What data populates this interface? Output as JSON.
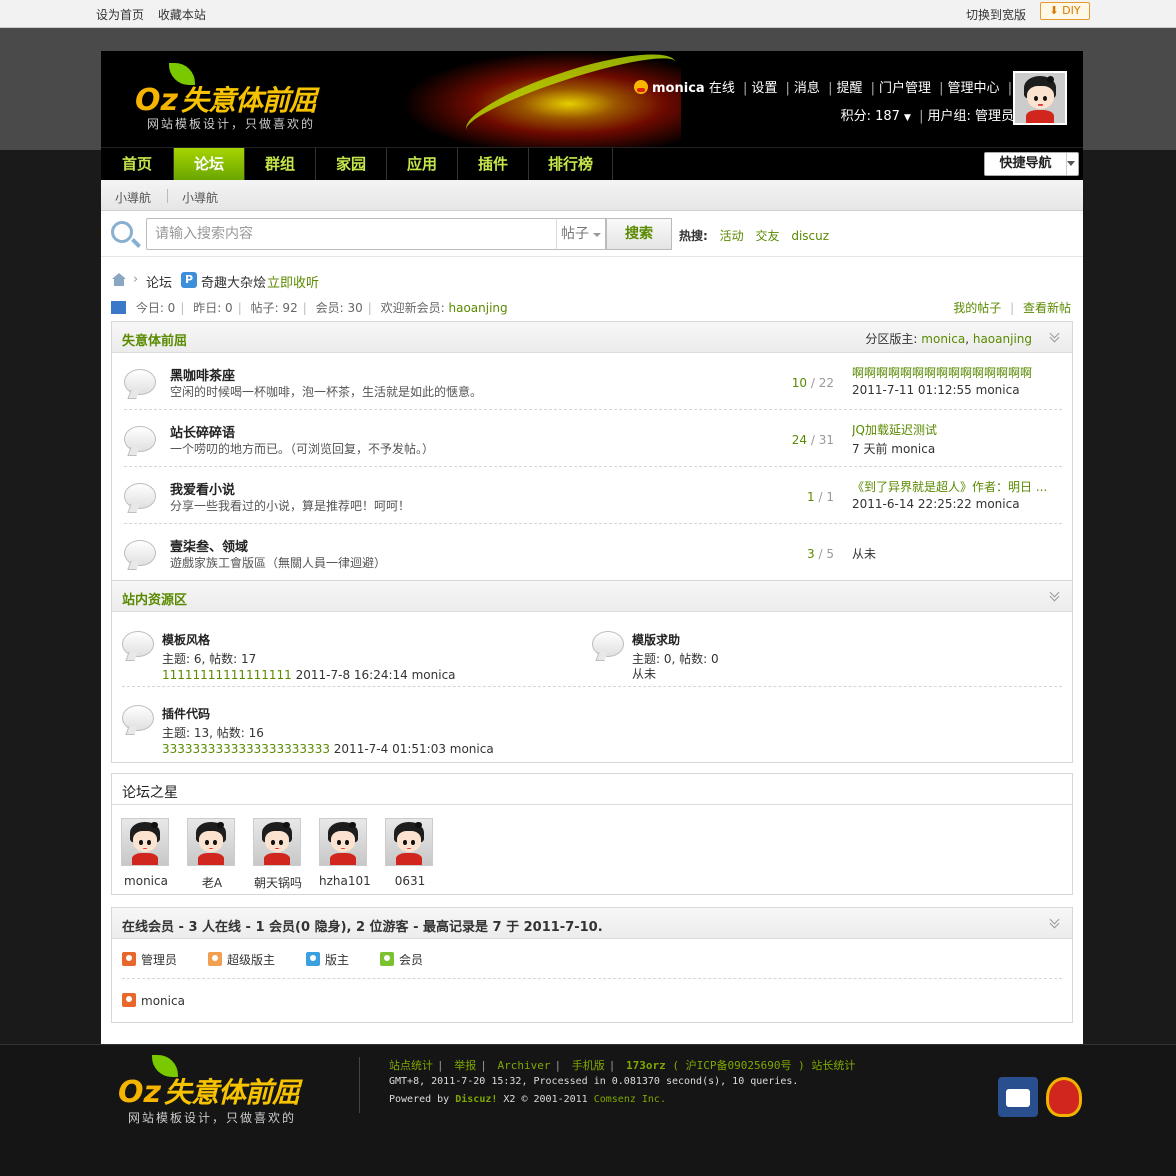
{
  "topbar": {
    "set_home": "设为首页",
    "bookmark": "收藏本站",
    "wide_switch": "切换到宽版",
    "diy": "DIY"
  },
  "logo": {
    "oz": "Oz",
    "name": "失意体前屈",
    "slogan": "网站模板设计，只做喜欢的"
  },
  "user": {
    "name": "monica",
    "status": "在线",
    "links": [
      "设置",
      "消息",
      "提醒",
      "门户管理",
      "管理中心",
      "退出"
    ],
    "points_label": "积分: 187",
    "group_label": "用户组: 管理员"
  },
  "nav": {
    "items": [
      "首页",
      "论坛",
      "群组",
      "家园",
      "应用",
      "插件",
      "排行榜"
    ],
    "quick": "快捷导航"
  },
  "subnav": [
    "小導航",
    "小導航"
  ],
  "search": {
    "placeholder": "请输入搜索内容",
    "scope": "帖子",
    "button": "搜索",
    "hot_label": "热搜:",
    "hot": [
      "活动",
      "交友",
      "discuz"
    ]
  },
  "breadcrumb": {
    "forum": "论坛",
    "name": "奇趣大杂烩",
    "listen": "立即收听"
  },
  "stats": {
    "today": "今日: 0",
    "yesterday": "昨日: 0",
    "posts": "帖子: 92",
    "members": "会员: 30",
    "welcome": "欢迎新会员:",
    "newest": "haoanjing",
    "my_posts": "我的帖子",
    "new_posts": "查看新帖"
  },
  "cat1": {
    "title": "失意体前屈",
    "mods_label": "分区版主:",
    "mod1": "monica",
    "mod2": "haoanjing",
    "forums": [
      {
        "name": "黑咖啡茶座",
        "desc": "空闲的时候喝一杯咖啡，泡一杯茶，生活就是如此的惬意。",
        "threads": "10",
        "posts": "22",
        "last_title": "啊啊啊啊啊啊啊啊啊啊啊啊啊啊啊",
        "last_info": "2011-7-11 01:12:55 monica"
      },
      {
        "name": "站长碎碎语",
        "desc": "一个唠叨的地方而已。（可浏览回复，不予发帖。）",
        "threads": "24",
        "posts": "31",
        "last_title": "JQ加载延迟测试",
        "last_info": "7 天前  monica"
      },
      {
        "name": "我爱看小说",
        "desc": "分享一些我看过的小说，算是推荐吧！呵呵！",
        "threads": "1",
        "posts": "1",
        "last_title": "《到了异界就是超人》作者：明日 ...",
        "last_info": "2011-6-14 22:25:22 monica"
      },
      {
        "name": "壹柒叁、领域",
        "desc": "遊戲家族工會版區（無關人員一律迴避）",
        "threads": "3",
        "posts": "5",
        "last_title": "",
        "last_info": "从未"
      }
    ]
  },
  "cat2": {
    "title": "站内资源区",
    "forums": [
      {
        "name": "模板风格",
        "meta": "主题: 6, 帖数: 17",
        "last_title": "11111111111111111",
        "last_info": " 2011-7-8 16:24:14 monica"
      },
      {
        "name": "模版求助",
        "meta": "主题: 0, 帖数: 0",
        "last_title": "",
        "last_info": "从未"
      },
      {
        "name": "插件代码",
        "meta": "主题: 13, 帖数: 16",
        "last_title": "3333333333333333333333",
        "last_info": " 2011-7-4 01:51:03 monica"
      }
    ]
  },
  "stars": {
    "title": "论坛之星",
    "users": [
      "monica",
      "老A",
      "朝天锅吗",
      "hzha101",
      "0631"
    ]
  },
  "online": {
    "title": "在线会员",
    "summary": " - 3 人在线  - 1 会员(0 隐身), 2 位游客  - 最高记录是  7 于  2011-7-10.",
    "legend": [
      {
        "label": "管理员",
        "color": "#e8672a"
      },
      {
        "label": "超级版主",
        "color": "#f0a050"
      },
      {
        "label": "版主",
        "color": "#3aa0e0"
      },
      {
        "label": "会员",
        "color": "#7cc230"
      }
    ],
    "users": [
      "monica"
    ]
  },
  "footer": {
    "links": [
      "站点统计",
      "举报",
      "Archiver",
      "手机版",
      "173orz",
      "( 沪ICP备09025690号 )",
      "站长统计"
    ],
    "line2": "GMT+8, 2011-7-20 15:32, Processed in 0.081370 second(s), 10 queries.",
    "powered": "Powered by ",
    "discuz": "Discuz!",
    "ver": " X2 © 2001-2011 ",
    "comsenz": "Comsenz Inc."
  }
}
